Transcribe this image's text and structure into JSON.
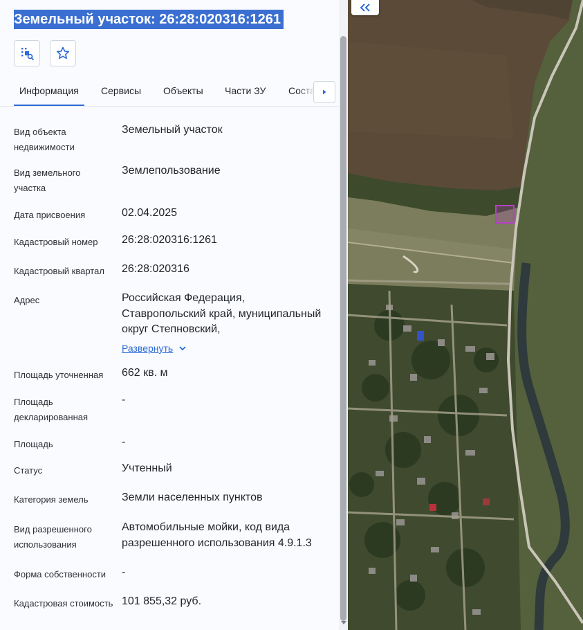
{
  "panel": {
    "title": "Земельный участок: 26:28:020316:1261",
    "tools": [
      "locate-on-map-icon",
      "star-icon"
    ]
  },
  "tabs": [
    {
      "label": "Информация",
      "active": true
    },
    {
      "label": "Сервисы",
      "active": false
    },
    {
      "label": "Объекты",
      "active": false
    },
    {
      "label": "Части ЗУ",
      "active": false
    },
    {
      "label": "Состав ЗУ",
      "active": false
    }
  ],
  "info": {
    "object_type_label": "Вид объекта недвижимости",
    "object_type_value": "Земельный участок",
    "land_type_label": "Вид земельного участка",
    "land_type_value": "Землепользование",
    "assign_date_label": "Дата присвоения",
    "assign_date_value": "02.04.2025",
    "cadastral_number_label": "Кадастровый номер",
    "cadastral_number_value": "26:28:020316:1261",
    "cadastral_quarter_label": "Кадастровый квартал",
    "cadastral_quarter_value": "26:28:020316",
    "address_label": "Адрес",
    "address_value": "Российская Федерация, Ставропольский край, муниципальный округ Степновский,",
    "address_expand": "Развернуть",
    "area_refined_label": "Площадь уточненная",
    "area_refined_value": "662 кв. м",
    "area_declared_label": "Площадь декларированная",
    "area_declared_value": "-",
    "area_label": "Площадь",
    "area_value": "-",
    "status_label": "Статус",
    "status_value": "Учтенный",
    "land_category_label": "Категория земель",
    "land_category_value": "Земли населенных пунктов",
    "permitted_use_label": "Вид разрешенного использования",
    "permitted_use_value": "Автомобильные мойки, код вида разрешенного использования 4.9.1.3",
    "ownership_label": "Форма собственности",
    "ownership_value": "-",
    "cadastral_value_label": "Кадастровая стоимость",
    "cadastral_value_value": "101 855,32 руб."
  },
  "colors": {
    "accent": "#2d6bd6",
    "title_highlight": "#3a6fd1",
    "parcel_outline": "#b53fc8"
  }
}
